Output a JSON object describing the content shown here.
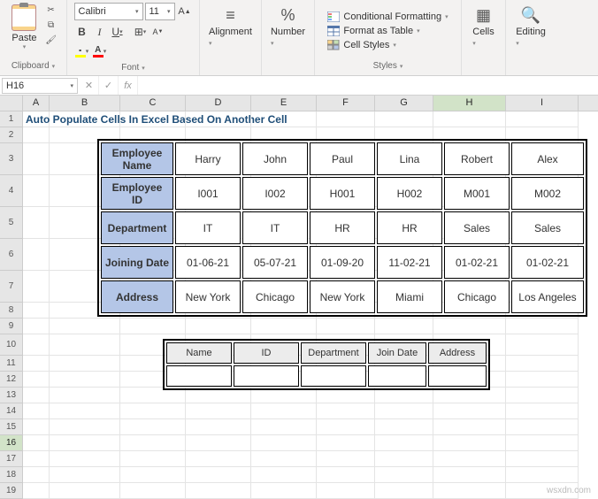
{
  "ribbon": {
    "paste_label": "Paste",
    "clipboard_label": "Clipboard",
    "font_name": "Calibri",
    "font_size": "11",
    "font_label": "Font",
    "alignment_label": "Alignment",
    "number_label": "Number",
    "cond_format": "Conditional Formatting",
    "as_table": "Format as Table",
    "cell_styles": "Cell Styles",
    "styles_label": "Styles",
    "cells_label": "Cells",
    "editing_label": "Editing"
  },
  "namebox": "H16",
  "formula": "",
  "columns": [
    "A",
    "B",
    "C",
    "D",
    "E",
    "F",
    "G",
    "H",
    "I"
  ],
  "selected_col": "H",
  "selected_row": "16",
  "title": "Auto Populate Cells In Excel Based On Another Cell",
  "emp": {
    "rows": [
      "Employee Name",
      "Employee ID",
      "Department",
      "Joining Date",
      "Address"
    ],
    "data": [
      [
        "Harry",
        "John",
        "Paul",
        "Lina",
        "Robert",
        "Alex"
      ],
      [
        "I001",
        "I002",
        "H001",
        "H002",
        "M001",
        "M002"
      ],
      [
        "IT",
        "IT",
        "HR",
        "HR",
        "Sales",
        "Sales"
      ],
      [
        "01-06-21",
        "05-07-21",
        "01-09-20",
        "11-02-21",
        "01-02-21",
        "01-02-21"
      ],
      [
        "New York",
        "Chicago",
        "New York",
        "Miami",
        "Chicago",
        "Los Angeles"
      ]
    ]
  },
  "lookup": {
    "headers": [
      "Name",
      "ID",
      "Department",
      "Join Date",
      "Address"
    ]
  },
  "watermark": "wsxdn.com"
}
